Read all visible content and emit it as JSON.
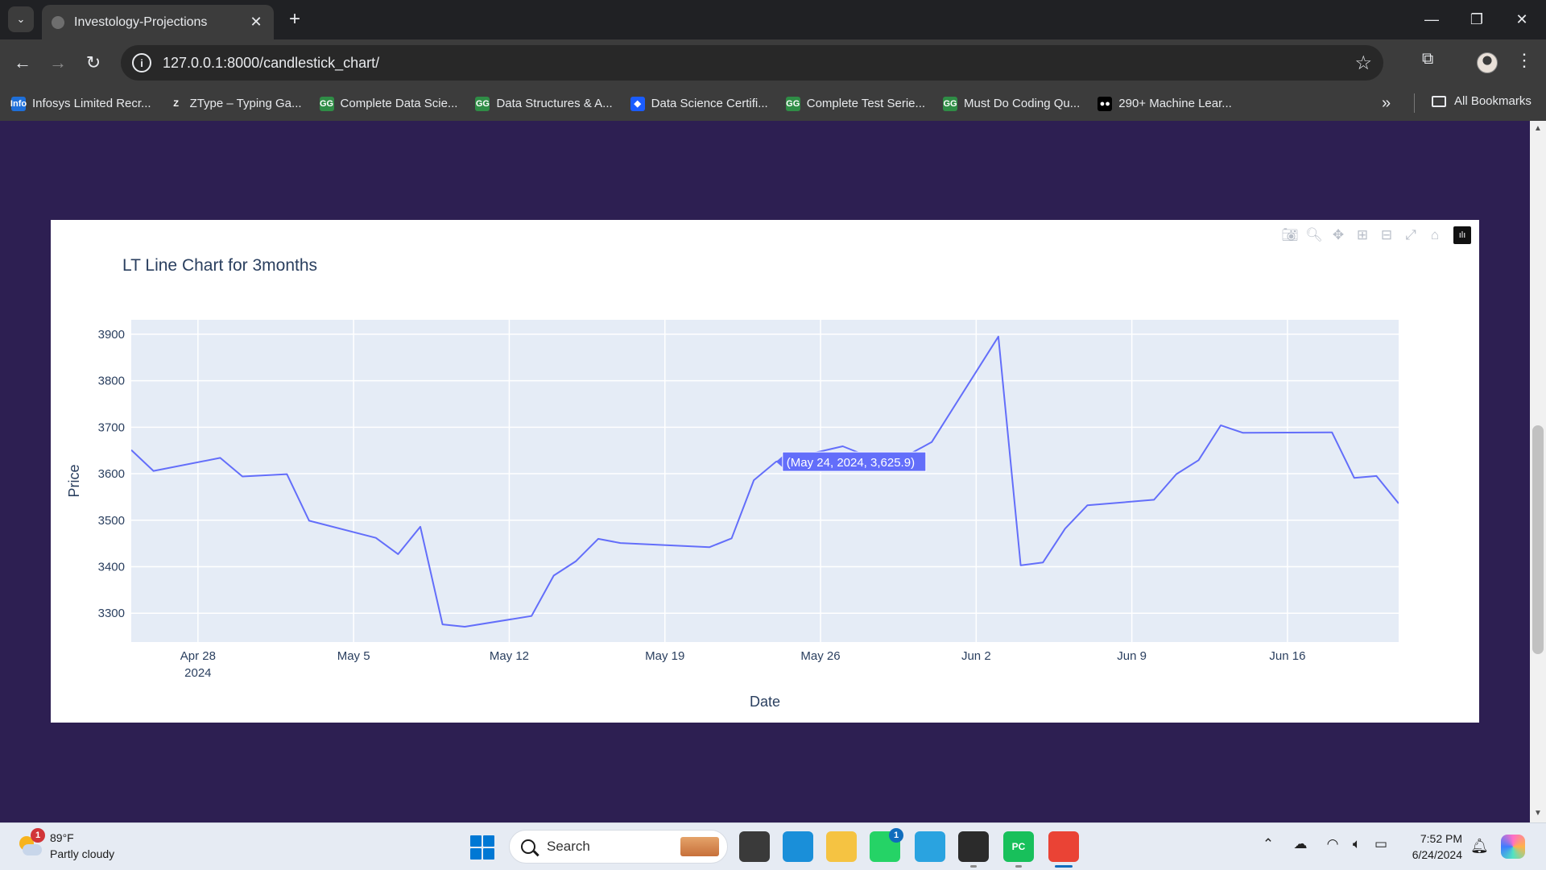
{
  "browser": {
    "tab_title": "Investology-Projections",
    "url": "127.0.0.1:8000/candlestick_chart/",
    "bookmarks": [
      {
        "label": "Infosys Limited Recr...",
        "icon": "infosys-icon",
        "icon_text": "Info",
        "color": "#1e6fd9"
      },
      {
        "label": "ZType – Typing Ga...",
        "icon": "ztype-icon",
        "icon_text": "Z",
        "color": "#3c3c3c"
      },
      {
        "label": "Complete Data Scie...",
        "icon": "geeksforgeeks-icon",
        "icon_text": "GG",
        "color": "#2f8d46"
      },
      {
        "label": "Data Structures & A...",
        "icon": "geeksforgeeks-icon",
        "icon_text": "GG",
        "color": "#2f8d46"
      },
      {
        "label": "Data Science Certifi...",
        "icon": "datascience-icon",
        "icon_text": "◆",
        "color": "#1a5cff"
      },
      {
        "label": "Complete Test Serie...",
        "icon": "geeksforgeeks-icon",
        "icon_text": "GG",
        "color": "#2f8d46"
      },
      {
        "label": "Must Do Coding Qu...",
        "icon": "geeksforgeeks-icon",
        "icon_text": "GG",
        "color": "#2f8d46"
      },
      {
        "label": "290+ Machine Lear...",
        "icon": "medium-icon",
        "icon_text": "●●",
        "color": "#000000"
      }
    ],
    "all_bookmarks_label": "All Bookmarks"
  },
  "page": {
    "background_color": "#2d1f52"
  },
  "chart_data": {
    "type": "line",
    "title": "LT Line Chart for 3months",
    "xlabel": "Date",
    "ylabel": "Price",
    "xlim": [
      "2024-04-25",
      "2024-06-21"
    ],
    "ylim": [
      3238,
      3931
    ],
    "x_ticks": [
      {
        "date": "2024-04-28",
        "label": "Apr 28",
        "sublabel": "2024"
      },
      {
        "date": "2024-05-05",
        "label": "May 5"
      },
      {
        "date": "2024-05-12",
        "label": "May 12"
      },
      {
        "date": "2024-05-19",
        "label": "May 19"
      },
      {
        "date": "2024-05-26",
        "label": "May 26"
      },
      {
        "date": "2024-06-02",
        "label": "Jun 2"
      },
      {
        "date": "2024-06-09",
        "label": "Jun 9"
      },
      {
        "date": "2024-06-16",
        "label": "Jun 16"
      }
    ],
    "y_ticks": [
      3300,
      3400,
      3500,
      3600,
      3700,
      3800,
      3900
    ],
    "grid": true,
    "line_color": "#636efa",
    "plot_background": "#e5ecf6",
    "series": [
      {
        "x": [
          "2024-04-25",
          "2024-04-26",
          "2024-04-29",
          "2024-04-30",
          "2024-05-02",
          "2024-05-03",
          "2024-05-06",
          "2024-05-07",
          "2024-05-08",
          "2024-05-09",
          "2024-05-10",
          "2024-05-13",
          "2024-05-14",
          "2024-05-15",
          "2024-05-16",
          "2024-05-17",
          "2024-05-21",
          "2024-05-22",
          "2024-05-23",
          "2024-05-24",
          "2024-05-27",
          "2024-05-28",
          "2024-05-29",
          "2024-05-30",
          "2024-05-31",
          "2024-06-03",
          "2024-06-04",
          "2024-06-05",
          "2024-06-06",
          "2024-06-07",
          "2024-06-10",
          "2024-06-11",
          "2024-06-12",
          "2024-06-13",
          "2024-06-14",
          "2024-06-18",
          "2024-06-19",
          "2024-06-20",
          "2024-06-21"
        ],
        "y": [
          3651,
          3606,
          3634,
          3594,
          3599,
          3499,
          3462,
          3427,
          3486,
          3276,
          3271,
          3294,
          3381,
          3412,
          3460,
          3451,
          3442,
          3461,
          3586,
          3625.9,
          3659,
          3640,
          3637,
          3642,
          3668,
          3895,
          3403,
          3409,
          3482,
          3532,
          3544,
          3599,
          3629,
          3704,
          3688,
          3689,
          3591,
          3595,
          3536
        ]
      }
    ],
    "tooltip": {
      "text": "(May 24, 2024, 3,625.9)",
      "date": "2024-05-24",
      "value": 3625.9
    }
  },
  "modebar": [
    "camera-icon",
    "zoom-icon",
    "pan-icon",
    "zoom-in-icon",
    "zoom-out-icon",
    "autoscale-icon",
    "reset-axes-icon",
    "plotly-logo-icon"
  ],
  "taskbar": {
    "weather_temp": "89°F",
    "weather_desc": "Partly cloudy",
    "weather_badge": "1",
    "search_label": "Search",
    "time": "7:52 PM",
    "date": "6/24/2024",
    "apps": [
      {
        "name": "task-view-icon",
        "color": "#3a3a3a"
      },
      {
        "name": "edge-icon",
        "color": "#1a8fd9"
      },
      {
        "name": "file-explorer-icon",
        "color": "#f5c342"
      },
      {
        "name": "whatsapp-icon",
        "color": "#25d366",
        "badge": "1"
      },
      {
        "name": "telegram-icon",
        "color": "#2aa3e0"
      },
      {
        "name": "terminal-icon",
        "color": "#2b2b2b"
      },
      {
        "name": "pycharm-icon",
        "color": "#18c05b",
        "label": "PC"
      },
      {
        "name": "chrome-icon",
        "color": "#ea4335"
      }
    ]
  }
}
